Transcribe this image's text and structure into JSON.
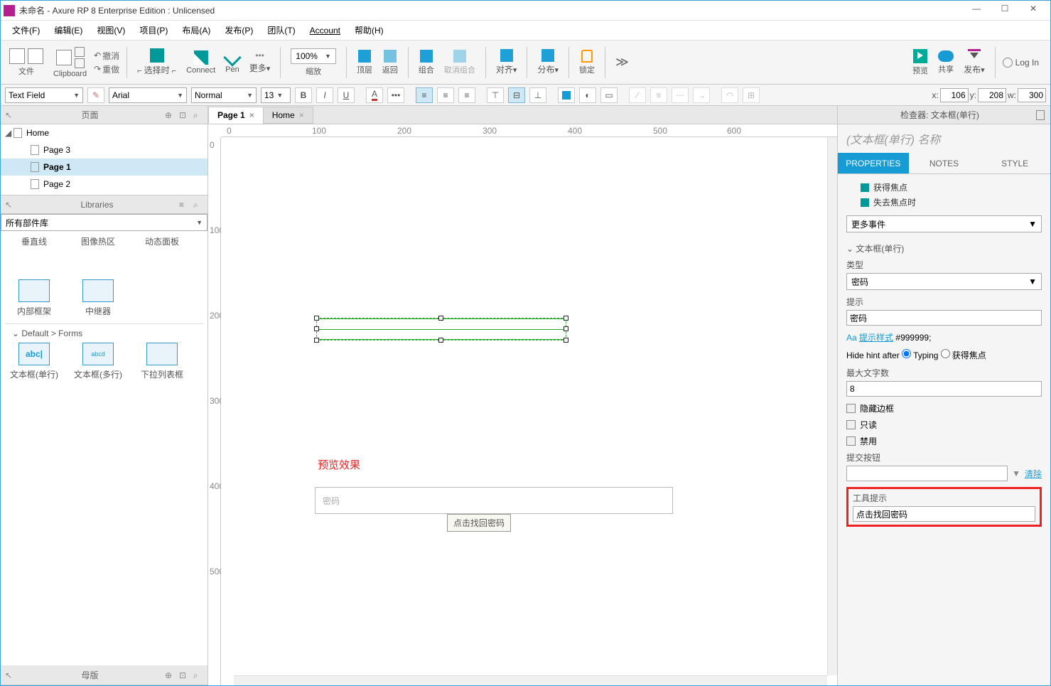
{
  "title": "未命名 - Axure RP 8 Enterprise Edition : Unlicensed",
  "menu": [
    "文件(F)",
    "编辑(E)",
    "视图(V)",
    "项目(P)",
    "布局(A)",
    "发布(P)",
    "团队(T)",
    "Account",
    "帮助(H)"
  ],
  "toolbar": {
    "file": "文件",
    "clipboard": "Clipboard",
    "undo": "撤消",
    "redo": "重做",
    "select": "选择时",
    "connect": "Connect",
    "pen": "Pen",
    "more": "更多",
    "zoom_label": "缩放",
    "zoom_value": "100%",
    "front": "顶层",
    "back": "返回",
    "group": "组合",
    "ungroup": "取消组合",
    "align": "对齐",
    "distribute": "分布",
    "lock": "锁定",
    "preview": "预览",
    "share": "共享",
    "publish": "发布",
    "login": "Log In",
    "overflow": "≫"
  },
  "format": {
    "widget_style": "Text Field",
    "font": "Arial",
    "weight": "Normal",
    "size": "13",
    "x": "106",
    "y": "208",
    "w": "300"
  },
  "pages": {
    "panel": "页面",
    "root": "Home",
    "items": [
      "Page 3",
      "Page 1",
      "Page 2"
    ],
    "selected": "Page 1"
  },
  "libraries": {
    "panel": "Libraries",
    "dropdown": "所有部件库",
    "row1": [
      "垂直线",
      "图像热区",
      "动态面板"
    ],
    "row2": [
      "内部框架",
      "中继器"
    ],
    "section": "Default > Forms",
    "row3": [
      "文本框(单行)",
      "文本框(多行)",
      "下拉列表框"
    ]
  },
  "masters": {
    "panel": "母版"
  },
  "tabs": [
    "Page 1",
    "Home"
  ],
  "ruler_h": [
    "0",
    "100",
    "200",
    "300",
    "400",
    "500",
    "600"
  ],
  "ruler_v": [
    "0",
    "100",
    "200",
    "300",
    "400",
    "500"
  ],
  "canvas": {
    "preview_label": "预览效果",
    "preview_placeholder": "密码",
    "tooltip": "点击找回密码"
  },
  "inspector": {
    "header": "检查器: 文本框(单行)",
    "name_placeholder": "(文本框(单行) 名称",
    "tabs": [
      "PROPERTIES",
      "NOTES",
      "STYLE"
    ],
    "events": [
      "获得焦点",
      "失去焦点时"
    ],
    "more_events": "更多事件",
    "section": "文本框(单行)",
    "type_label": "类型",
    "type_value": "密码",
    "hint_label": "提示",
    "hint_value": "密码",
    "hint_style": "提示样式",
    "hint_color": "#999999;",
    "hide_hint": "Hide hint after",
    "typing": "Typing",
    "gotfocus": "获得焦点",
    "maxlen_label": "最大文字数",
    "maxlen_value": "8",
    "hide_border": "隐藏边框",
    "readonly": "只读",
    "disabled": "禁用",
    "submit_label": "提交按钮",
    "clear": "清除",
    "tooltip_label": "工具提示",
    "tooltip_value": "点击找回密码"
  }
}
